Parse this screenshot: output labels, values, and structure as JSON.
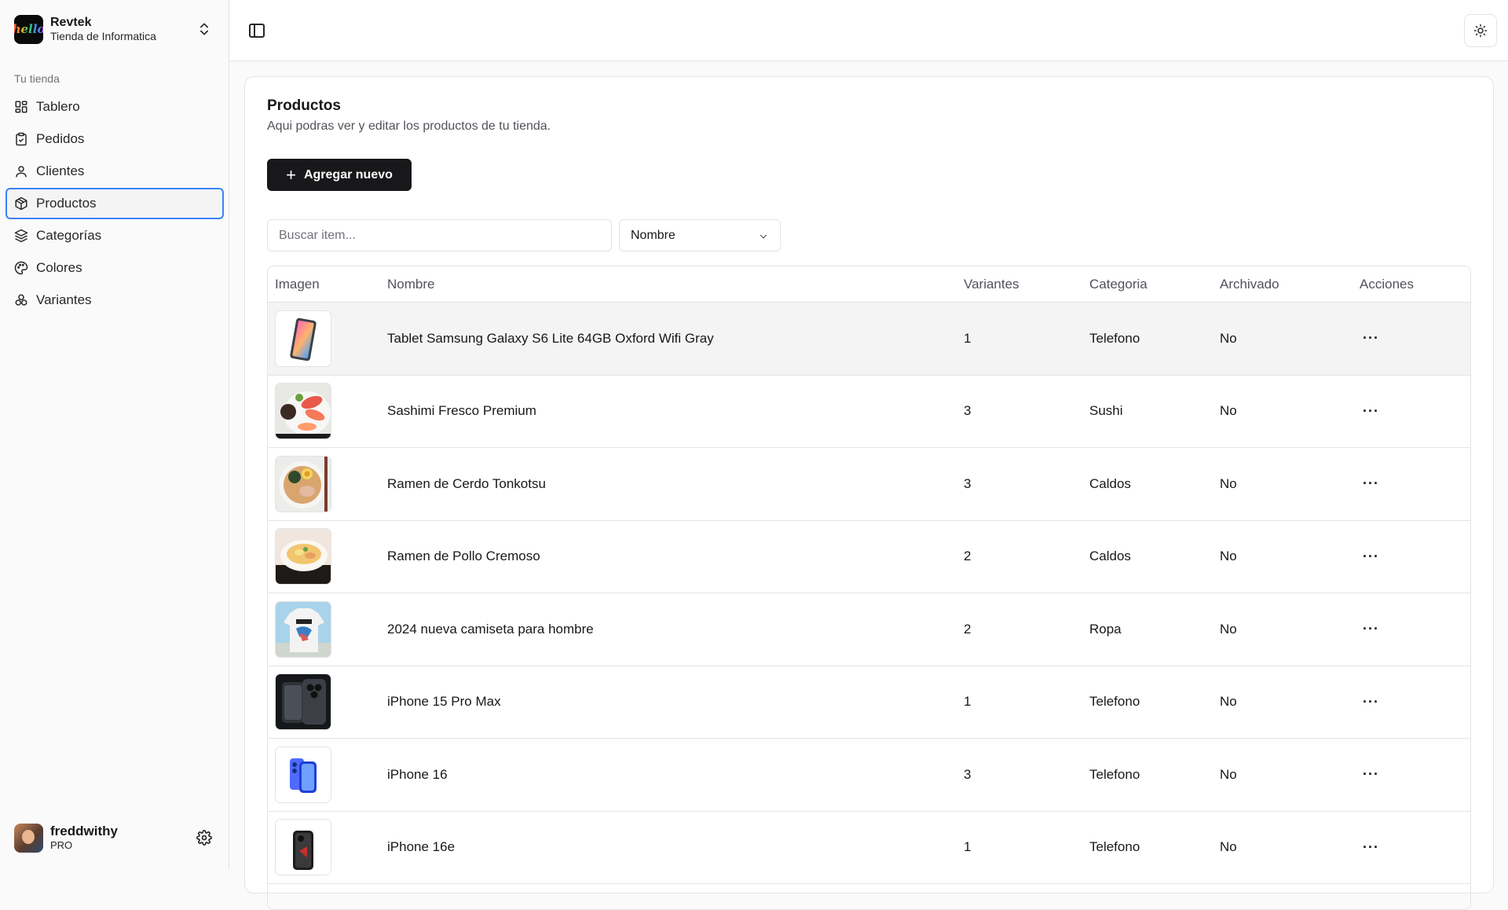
{
  "sidebar": {
    "store": {
      "name": "Revtek",
      "subtitle": "Tienda de Informatica",
      "logo_text": "hello"
    },
    "section_label": "Tu tienda",
    "items": [
      {
        "label": "Tablero",
        "icon": "dashboard-icon"
      },
      {
        "label": "Pedidos",
        "icon": "clipboard-icon"
      },
      {
        "label": "Clientes",
        "icon": "user-icon"
      },
      {
        "label": "Productos",
        "icon": "package-icon",
        "active": true
      },
      {
        "label": "Categorías",
        "icon": "layers-icon"
      },
      {
        "label": "Colores",
        "icon": "palette-icon"
      },
      {
        "label": "Variantes",
        "icon": "shapes-icon"
      }
    ],
    "user": {
      "name": "freddwithy",
      "plan": "PRO"
    }
  },
  "page": {
    "title": "Productos",
    "subtitle": "Aqui podras ver y editar los productos de tu tienda.",
    "add_button": "Agregar nuevo",
    "search_placeholder": "Buscar item...",
    "sort_select": "Nombre"
  },
  "table": {
    "headers": [
      "Imagen",
      "Nombre",
      "Variantes",
      "Categoria",
      "Archivado",
      "Acciones"
    ],
    "rows": [
      {
        "name": "Tablet Samsung Galaxy S6 Lite 64GB Oxford Wifi Gray",
        "variants": "1",
        "category": "Telefono",
        "archived": "No",
        "thumb": "tablet"
      },
      {
        "name": "Sashimi Fresco Premium",
        "variants": "3",
        "category": "Sushi",
        "archived": "No",
        "thumb": "sashimi"
      },
      {
        "name": "Ramen de Cerdo Tonkotsu",
        "variants": "3",
        "category": "Caldos",
        "archived": "No",
        "thumb": "ramen"
      },
      {
        "name": "Ramen de Pollo Cremoso",
        "variants": "2",
        "category": "Caldos",
        "archived": "No",
        "thumb": "ramen-pollo"
      },
      {
        "name": "2024 nueva camiseta para hombre",
        "variants": "2",
        "category": "Ropa",
        "archived": "No",
        "thumb": "tshirt"
      },
      {
        "name": "iPhone 15 Pro Max",
        "variants": "1",
        "category": "Telefono",
        "archived": "No",
        "thumb": "iphone15"
      },
      {
        "name": "iPhone 16",
        "variants": "3",
        "category": "Telefono",
        "archived": "No",
        "thumb": "iphone16"
      },
      {
        "name": "iPhone 16e",
        "variants": "1",
        "category": "Telefono",
        "archived": "No",
        "thumb": "iphone16e"
      }
    ],
    "actions_glyph": "···"
  },
  "colors": {
    "accent": "#3b82f6",
    "primary": "#18181b",
    "border": "#e4e4e7",
    "muted": "#71717a"
  }
}
